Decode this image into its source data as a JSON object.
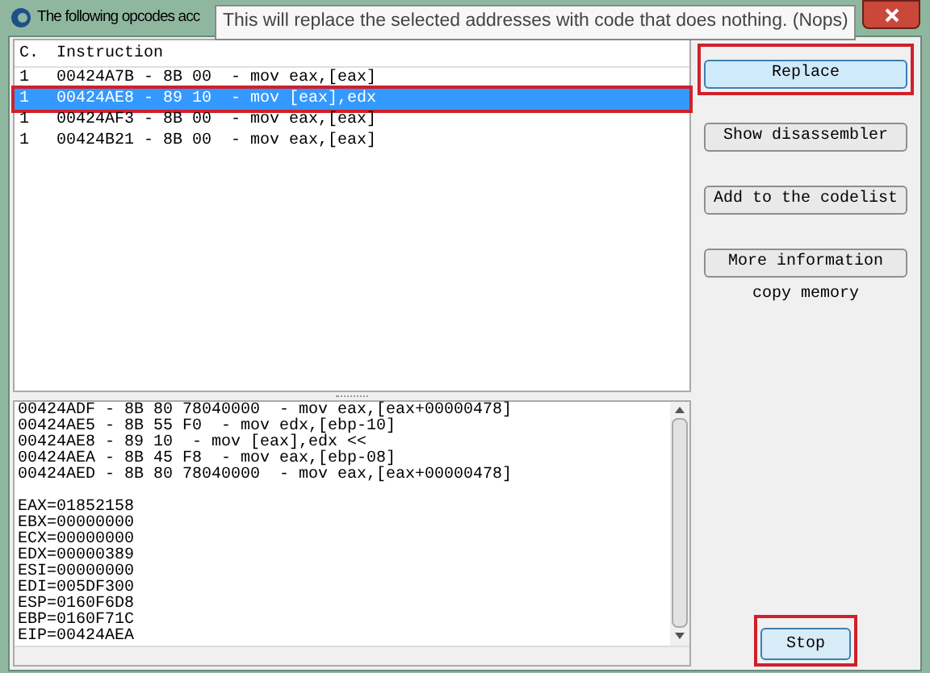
{
  "window": {
    "title": "The following opcodes acc"
  },
  "tooltip": "This will replace the selected addresses with code that does nothing. (Nops)",
  "list": {
    "columns": [
      "C.",
      "Instruction"
    ],
    "rows": [
      {
        "count": "1",
        "instruction": "00424A7B - 8B 00  - mov eax,[eax]",
        "selected": false,
        "annotated": false
      },
      {
        "count": "1",
        "instruction": "00424AE8 - 89 10  - mov [eax],edx",
        "selected": true,
        "annotated": true
      },
      {
        "count": "1",
        "instruction": "00424AF3 - 8B 00  - mov eax,[eax]",
        "selected": false,
        "annotated": false
      },
      {
        "count": "1",
        "instruction": "00424B21 - 8B 00  - mov eax,[eax]",
        "selected": false,
        "annotated": false
      }
    ]
  },
  "buttons": [
    {
      "label": "Replace",
      "hovered": true,
      "annotated": true
    },
    {
      "label": "Show disassembler",
      "hovered": false,
      "annotated": false
    },
    {
      "label": "Add to the codelist",
      "hovered": false,
      "annotated": false
    },
    {
      "label": "More information",
      "hovered": false,
      "annotated": false
    }
  ],
  "copy_memory": "copy memory",
  "code_lines": [
    "00424ADF - 8B 80 78040000  - mov eax,[eax+00000478]",
    "00424AE5 - 8B 55 F0  - mov edx,[ebp-10]",
    "00424AE8 - 89 10  - mov [eax],edx <<",
    "00424AEA - 8B 45 F8  - mov eax,[ebp-08]",
    "00424AED - 8B 80 78040000  - mov eax,[eax+00000478]"
  ],
  "registers": [
    "EAX=01852158",
    "EBX=00000000",
    "ECX=00000000",
    "EDX=00000389",
    "ESI=00000000",
    "EDI=005DF300",
    "ESP=0160F6D8",
    "EBP=0160F71C",
    "EIP=00424AEA"
  ],
  "stop_button": {
    "label": "Stop",
    "annotated": true
  }
}
